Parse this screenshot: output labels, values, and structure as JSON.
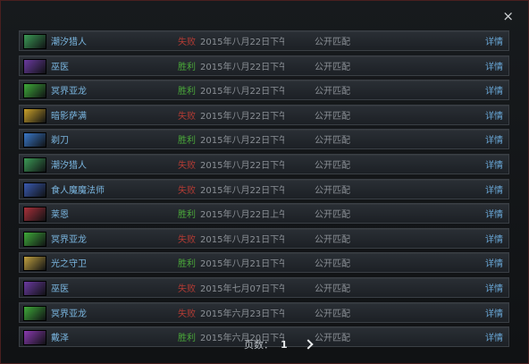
{
  "close_glyph": "×",
  "matches": [
    {
      "hero": "潮汐猎人",
      "result": "失败",
      "status": "lose",
      "date": "2015年八月22日下午1",
      "mode": "公开匹配",
      "details": "详情",
      "icon": "tidehunter-icon",
      "color": "#3c9a56"
    },
    {
      "hero": "巫医",
      "result": "胜利",
      "status": "win",
      "date": "2015年八月22日下午1(",
      "mode": "公开匹配",
      "details": "详情",
      "icon": "witch-doctor-icon",
      "color": "#6b3aa0"
    },
    {
      "hero": "冥界亚龙",
      "result": "胜利",
      "status": "win",
      "date": "2015年八月22日下午9:",
      "mode": "公开匹配",
      "details": "详情",
      "icon": "viper-icon",
      "color": "#3faa3a"
    },
    {
      "hero": "暗影萨满",
      "result": "失败",
      "status": "lose",
      "date": "2015年八月22日下午8:",
      "mode": "公开匹配",
      "details": "详情",
      "icon": "shadow-shaman-icon",
      "color": "#c9a02a"
    },
    {
      "hero": "剃刀",
      "result": "胜利",
      "status": "win",
      "date": "2015年八月22日下午4:",
      "mode": "公开匹配",
      "details": "详情",
      "icon": "razor-icon",
      "color": "#3a78c8"
    },
    {
      "hero": "潮汐猎人",
      "result": "失败",
      "status": "lose",
      "date": "2015年八月22日下午3:",
      "mode": "公开匹配",
      "details": "详情",
      "icon": "tidehunter-icon",
      "color": "#3c9a56"
    },
    {
      "hero": "食人魔魔法师",
      "result": "失败",
      "status": "lose",
      "date": "2015年八月22日下午3:",
      "mode": "公开匹配",
      "details": "详情",
      "icon": "ogre-magi-icon",
      "color": "#3a5ab0"
    },
    {
      "hero": "莱恩",
      "result": "胜利",
      "status": "win",
      "date": "2015年八月22日上午1:",
      "mode": "公开匹配",
      "details": "详情",
      "icon": "lion-icon",
      "color": "#a8303a"
    },
    {
      "hero": "冥界亚龙",
      "result": "失败",
      "status": "lose",
      "date": "2015年八月21日下午1",
      "mode": "公开匹配",
      "details": "详情",
      "icon": "viper-icon",
      "color": "#3faa3a"
    },
    {
      "hero": "光之守卫",
      "result": "胜利",
      "status": "win",
      "date": "2015年八月21日下午1(",
      "mode": "公开匹配",
      "details": "详情",
      "icon": "keeper-of-the-light-icon",
      "color": "#c0a040"
    },
    {
      "hero": "巫医",
      "result": "失败",
      "status": "lose",
      "date": "2015年七月07日下午1(",
      "mode": "公开匹配",
      "details": "详情",
      "icon": "witch-doctor-icon",
      "color": "#6b3aa0"
    },
    {
      "hero": "冥界亚龙",
      "result": "失败",
      "status": "lose",
      "date": "2015年六月23日下午1(",
      "mode": "公开匹配",
      "details": "详情",
      "icon": "viper-icon",
      "color": "#3faa3a"
    },
    {
      "hero": "戴泽",
      "result": "胜利",
      "status": "win",
      "date": "2015年六月20日下午1",
      "mode": "公开匹配",
      "details": "详情",
      "icon": "dazzle-icon",
      "color": "#8a3ab0"
    }
  ],
  "pager": {
    "label": "页数：",
    "page": "1"
  }
}
